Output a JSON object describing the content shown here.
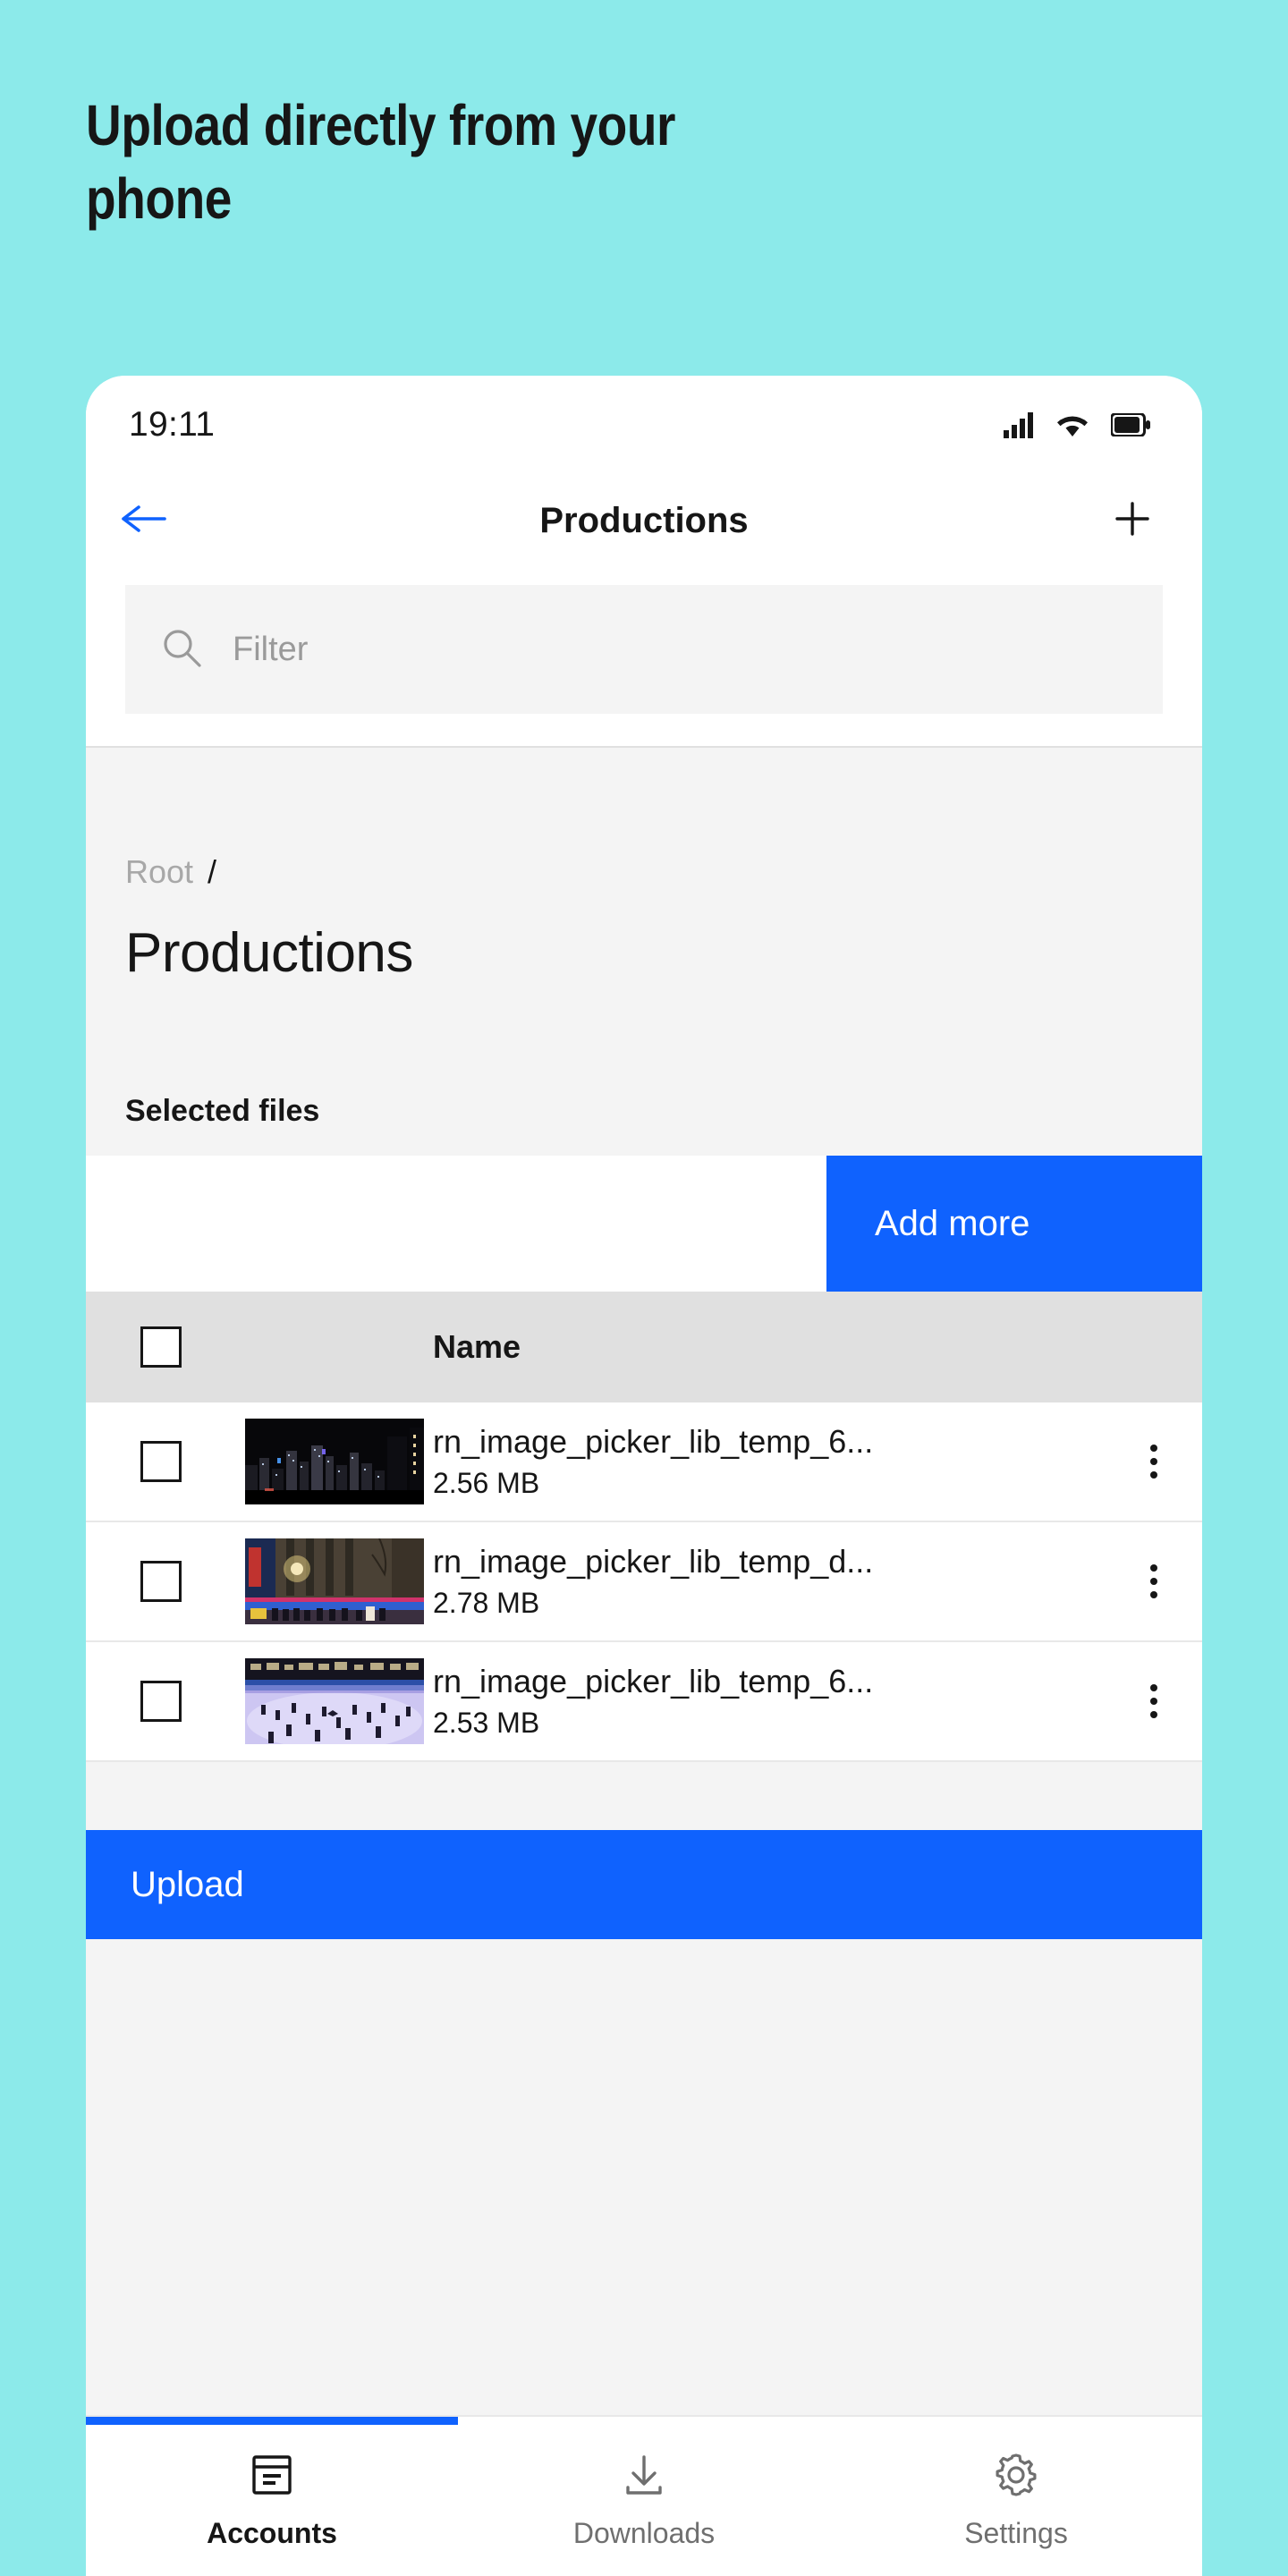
{
  "promo": {
    "heading_line1": "Upload directly from your",
    "heading_line2": "phone",
    "background_color": "#8CEAEA"
  },
  "colors": {
    "accent_blue": "#0f62fe",
    "text_primary": "#161616",
    "text_muted": "#6f6f6f",
    "surface_gray": "#f4f4f4",
    "header_gray": "#e0e0e0"
  },
  "status_bar": {
    "time": "19:11",
    "icons": [
      "cellular-signal-icon",
      "wifi-icon",
      "battery-icon"
    ]
  },
  "app_bar": {
    "back_icon": "arrow-left-icon",
    "title": "Productions",
    "add_icon": "plus-icon"
  },
  "search": {
    "icon": "search-icon",
    "placeholder": "Filter",
    "value": ""
  },
  "breadcrumb": {
    "root_label": "Root",
    "separator": "/"
  },
  "folder": {
    "title": "Productions"
  },
  "selected_files": {
    "section_label": "Selected files",
    "add_more_label": "Add more"
  },
  "table": {
    "header_checkbox_checked": false,
    "columns": [
      "",
      "",
      "Name",
      ""
    ],
    "name_column_label": "Name",
    "rows": [
      {
        "checked": false,
        "thumbnail": "night-city-skyline-thumbnail",
        "name": "rn_image_picker_lib_temp_6...",
        "size": "2.56 MB",
        "menu_icon": "overflow-menu-icon"
      },
      {
        "checked": false,
        "thumbnail": "radio-city-street-thumbnail",
        "name": "rn_image_picker_lib_temp_d...",
        "size": "2.78 MB",
        "menu_icon": "overflow-menu-icon"
      },
      {
        "checked": false,
        "thumbnail": "ice-skating-rink-thumbnail",
        "name": "rn_image_picker_lib_temp_6...",
        "size": "2.53 MB",
        "menu_icon": "overflow-menu-icon"
      }
    ]
  },
  "upload": {
    "label": "Upload"
  },
  "tab_bar": {
    "items": [
      {
        "label": "Accounts",
        "icon": "accounts-icon",
        "active": true
      },
      {
        "label": "Downloads",
        "icon": "download-icon",
        "active": false
      },
      {
        "label": "Settings",
        "icon": "gear-icon",
        "active": false
      }
    ]
  }
}
